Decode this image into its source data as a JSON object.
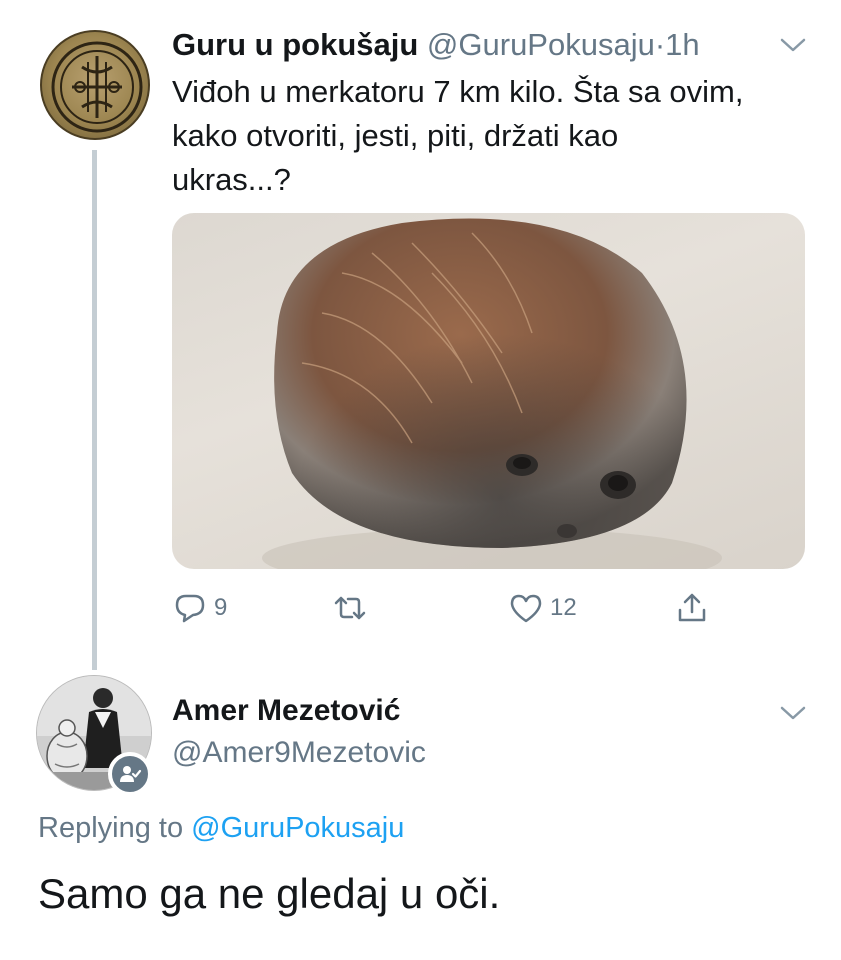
{
  "tweet": {
    "author_name": "Guru u pokušaju",
    "author_handle": "@GuruPokusaju",
    "separator": "·",
    "time": "1h",
    "text_lines": [
      "Viđoh u merkatoru 7 km kilo. Šta sa ovim,",
      "kako otvoriti, jesti, piti, držati kao",
      "ukras...?"
    ],
    "avatar_icon": "sigil-seal-icon",
    "media_icon": "coconut-photo",
    "actions": {
      "reply_count": "9",
      "retweet_count": "",
      "like_count": "12"
    }
  },
  "reply": {
    "author_name": "Amer Mezetović",
    "author_handle": "@Amer9Mezetovic",
    "replying_prefix": "Replying to",
    "replying_to": "@GuruPokusaju",
    "text": "Samo ga ne gledaj u oči.",
    "avatar_icon": "vintage-photo-avatar",
    "badge_icon": "follow-user-icon"
  },
  "colors": {
    "text": "#14171a",
    "secondary": "#657786",
    "link": "#1da1f2",
    "thread_line": "#c4cdd3"
  }
}
